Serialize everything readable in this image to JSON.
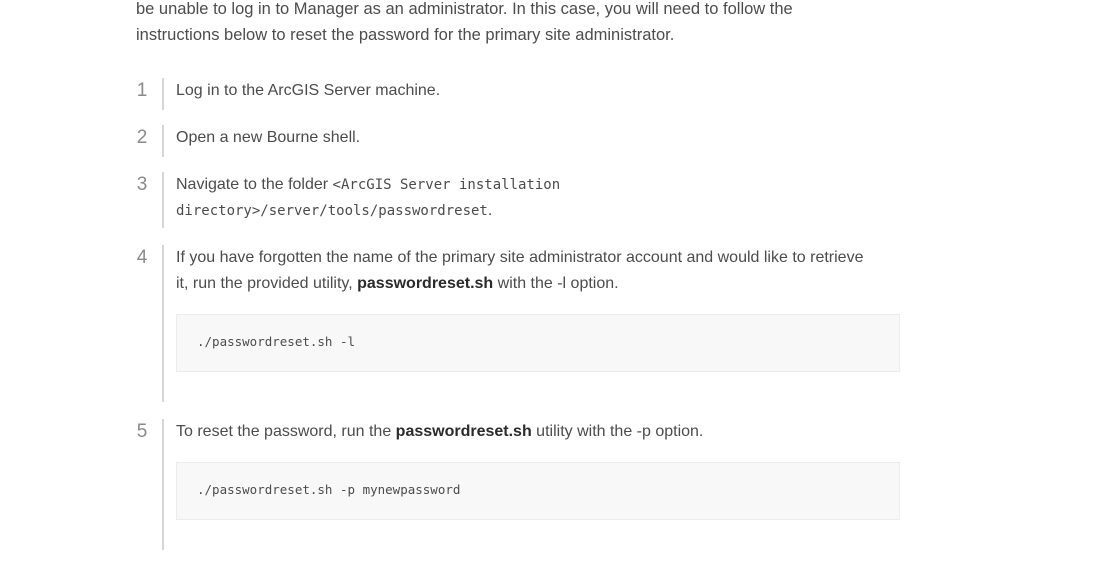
{
  "intro": {
    "line1": "be unable to log in to Manager as an administrator. In this case, you will need to follow the",
    "line2": "instructions below to reset the password for the primary site administrator."
  },
  "steps": [
    {
      "number": "1",
      "text": "Log in to the ArcGIS Server machine."
    },
    {
      "number": "2",
      "text": "Open a new Bourne shell."
    },
    {
      "number": "3",
      "text_before": "Navigate to the folder ",
      "code_line1": "<ArcGIS Server installation",
      "code_line2": "directory>/server/tools/passwordreset",
      "text_after": "."
    },
    {
      "number": "4",
      "line1": "If you have forgotten the name of the primary site administrator account and would like to retrieve",
      "line2_before": "it, run the provided utility, ",
      "bold": "passwordreset.sh",
      "line2_after": " with the -l option.",
      "code": "./passwordreset.sh -l"
    },
    {
      "number": "5",
      "text_before": "To reset the password, run the ",
      "bold": "passwordreset.sh",
      "text_after": " utility with the -p option.",
      "code": "./passwordreset.sh -p mynewpassword"
    }
  ]
}
